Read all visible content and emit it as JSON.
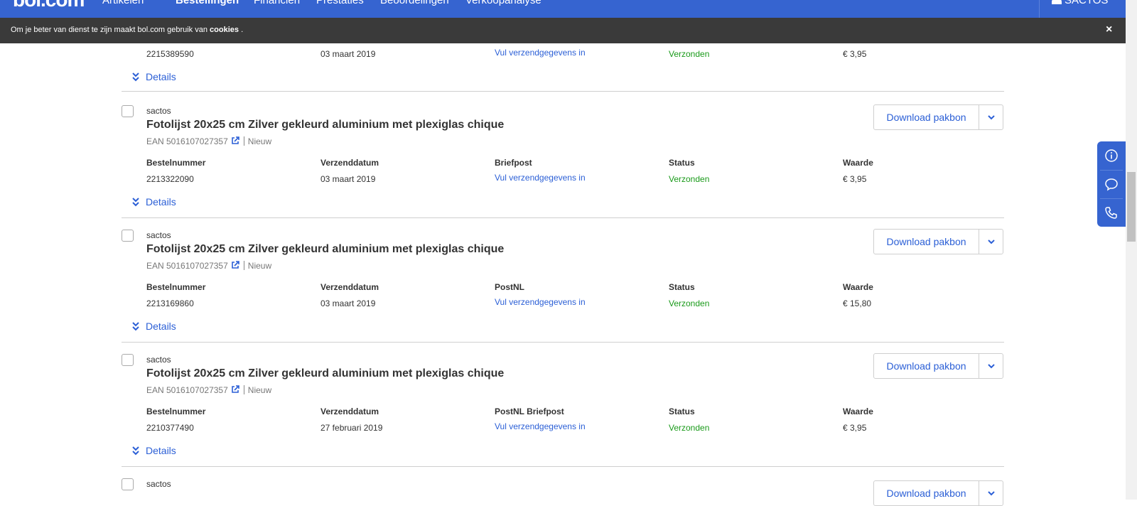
{
  "nav": {
    "logo": "bol.com",
    "items": [
      {
        "label": "Artikelen"
      },
      {
        "label": "Bestellingen"
      },
      {
        "label": "Financiën"
      },
      {
        "label": "Prestaties"
      },
      {
        "label": "Beoordelingen"
      },
      {
        "label": "Verkoopanalyse"
      }
    ],
    "user": "SACTOS"
  },
  "cookie": {
    "text": "Om je beter van dienst te zijn maakt bol.com gebruik van",
    "link": "cookies",
    "suffix": ".",
    "close": "×"
  },
  "labels": {
    "bestelnummer": "Bestelnummer",
    "verzenddatum": "Verzenddatum",
    "status": "Status",
    "waarde": "Waarde",
    "details": "Details",
    "download": "Download pakbon",
    "nieuw": "Nieuw"
  },
  "first_partial": {
    "bestelnummer": "2215389590",
    "verzenddatum": "03 maart 2019",
    "vul": "Vul verzendgegevens in",
    "status": "Verzonden",
    "waarde": "€ 3,95"
  },
  "orders": [
    {
      "seller": "sactos",
      "title": "Fotolijst 20x25 cm Zilver gekleurd aluminium met plexiglas chique",
      "ean": "EAN 5016107027357",
      "method": "Briefpost",
      "bestelnummer": "2213322090",
      "verzenddatum": "03 maart 2019",
      "vul": "Vul verzendgegevens in",
      "status": "Verzonden",
      "waarde": "€ 3,95"
    },
    {
      "seller": "sactos",
      "title": "Fotolijst 20x25 cm Zilver gekleurd aluminium met plexiglas chique",
      "ean": "EAN 5016107027357",
      "method": "PostNL",
      "bestelnummer": "2213169860",
      "verzenddatum": "03 maart 2019",
      "vul": "Vul verzendgegevens in",
      "status": "Verzonden",
      "waarde": "€ 15,80"
    },
    {
      "seller": "sactos",
      "title": "Fotolijst 20x25 cm Zilver gekleurd aluminium met plexiglas chique",
      "ean": "EAN 5016107027357",
      "method": "PostNL Briefpost",
      "bestelnummer": "2210377490",
      "verzenddatum": "27 februari 2019",
      "vul": "Vul verzendgegevens in",
      "status": "Verzonden",
      "waarde": "€ 3,95"
    }
  ],
  "last_partial": {
    "seller": "sactos",
    "download": "Download pakbon"
  },
  "colors": {
    "brand": "#3664d0",
    "link": "#2b5fd6",
    "status_green": "#1a9a1a"
  },
  "icons": {
    "side": [
      "info-icon",
      "chat-icon",
      "phone-icon"
    ]
  }
}
